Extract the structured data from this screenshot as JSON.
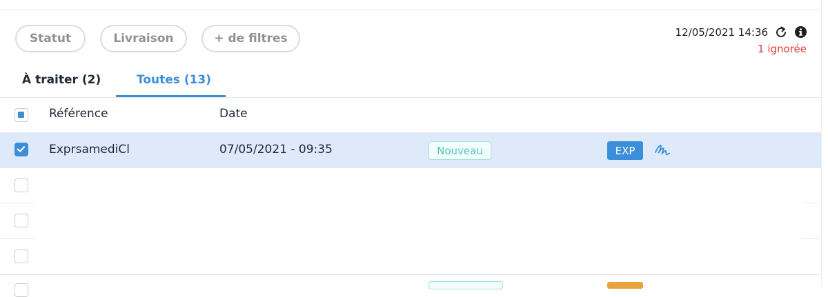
{
  "filters": {
    "statut_label": "Statut",
    "livraison_label": "Livraison",
    "more_label": "+ de filtres"
  },
  "status": {
    "timestamp": "12/05/2021 14:36",
    "ignored": "1 ignorée"
  },
  "tabs": [
    {
      "label": "À traiter (2)",
      "active": false
    },
    {
      "label": "Toutes (13)",
      "active": true
    }
  ],
  "table": {
    "headers": {
      "reference": "Référence",
      "date": "Date"
    },
    "rows": [
      {
        "reference": "ExprsamediCl",
        "date": "07/05/2021 - 09:35",
        "status": "Nouveau",
        "type": "EXP",
        "selected": true,
        "action_icon": "signature-icon"
      }
    ]
  },
  "icons": {
    "refresh": "refresh-icon",
    "info": "info-icon",
    "signature": "signature-icon"
  },
  "colors": {
    "accent": "#3b8fd9",
    "selected_row": "#deeafa",
    "status_new": "#4cc9bd",
    "warning": "#e53935",
    "exp_badge": "#3b8fd9",
    "partial_badge": "#e8a33e"
  }
}
